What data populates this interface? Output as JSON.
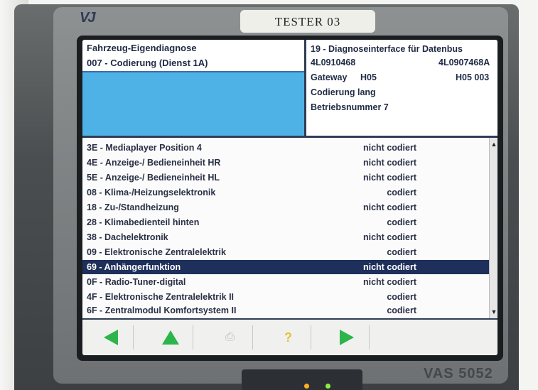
{
  "device": {
    "logo": "VJ",
    "tester_label": "TESTER 03",
    "model_label": "VAS 5052"
  },
  "header": {
    "title": "Fahrzeug-Eigendiagnose",
    "subtitle": "007 - Codierung (Dienst 1A)",
    "info": {
      "line1": "19 - Diagnoseinterface für Datenbus",
      "part_no_left": "4L0910468",
      "part_no_right": "4L0907468A",
      "gateway_label": "Gateway",
      "gateway_version": "H05",
      "gateway_version_right": "H05 003",
      "coding": "Codierung lang",
      "dealer": "Betriebsnummer 7"
    }
  },
  "list": {
    "rows": [
      {
        "name": "3E - Mediaplayer Position 4",
        "status": "nicht codiert"
      },
      {
        "name": "4E - Anzeige-/ Bedieneinheit HR",
        "status": "nicht codiert"
      },
      {
        "name": "5E - Anzeige-/ Bedieneinheit HL",
        "status": "nicht codiert"
      },
      {
        "name": "08 - Klima-/Heizungselektronik",
        "status": "codiert"
      },
      {
        "name": "18 - Zu-/Standheizung",
        "status": "nicht codiert"
      },
      {
        "name": "28 - Klimabedienteil hinten",
        "status": "codiert"
      },
      {
        "name": "38 - Dachelektronik",
        "status": "nicht codiert"
      },
      {
        "name": "09 - Elektronische Zentralelektrik",
        "status": "codiert"
      },
      {
        "name": "69 - Anhängerfunktion",
        "status": "nicht codiert"
      },
      {
        "name": "0F - Radio-Tuner-digital",
        "status": "nicht codiert"
      },
      {
        "name": "4F - Elektronische Zentralelektrik II",
        "status": "codiert"
      },
      {
        "name": "6F - Zentralmodul Komfortsystem II",
        "status": "codiert"
      }
    ],
    "selected_index": 8
  },
  "toolbar": {
    "buttons": [
      "back-arrow-icon",
      "up-arrow-icon",
      "print-icon",
      "help-icon",
      "forward-arrow-icon"
    ]
  },
  "colors": {
    "selection": "#1e2f5c",
    "header_blue": "#4fb2e6",
    "arrow_green": "#2db44a"
  }
}
